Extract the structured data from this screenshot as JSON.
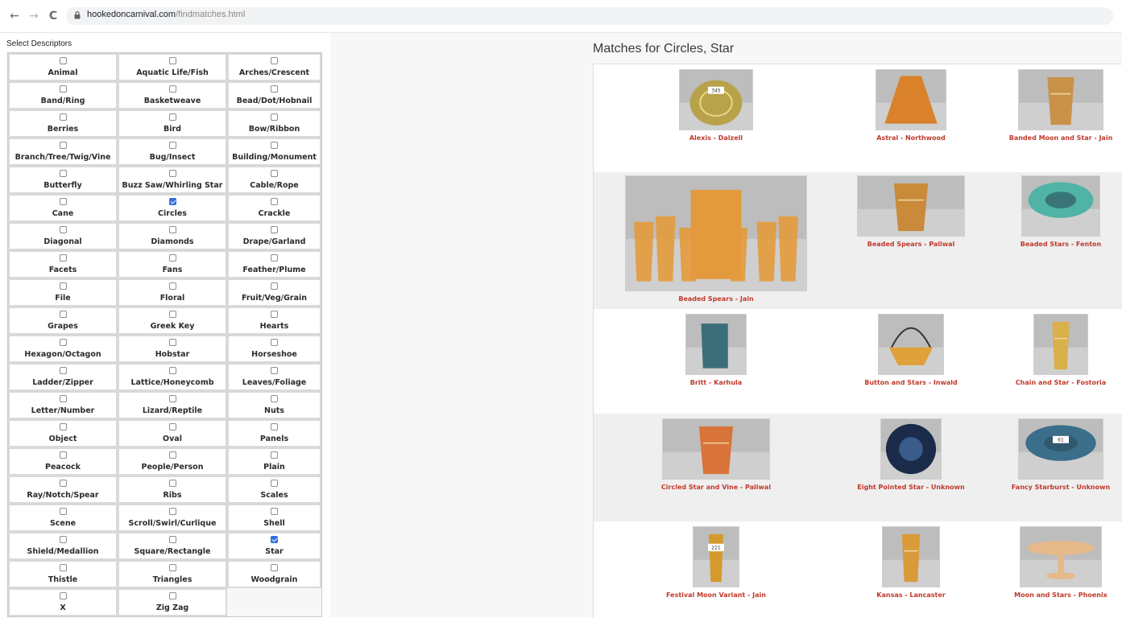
{
  "browser": {
    "back": "←",
    "forward": "→",
    "reload": "C",
    "url_host": "hookedoncarnival.com",
    "url_path": "/findmatches.html"
  },
  "descriptors": {
    "title": "Select Descriptors",
    "items": [
      {
        "label": "Animal",
        "checked": false
      },
      {
        "label": "Aquatic Life/Fish",
        "checked": false
      },
      {
        "label": "Arches/Crescent",
        "checked": false
      },
      {
        "label": "Band/Ring",
        "checked": false
      },
      {
        "label": "Basketweave",
        "checked": false
      },
      {
        "label": "Bead/Dot/Hobnail",
        "checked": false
      },
      {
        "label": "Berries",
        "checked": false
      },
      {
        "label": "Bird",
        "checked": false
      },
      {
        "label": "Bow/Ribbon",
        "checked": false
      },
      {
        "label": "Branch/Tree/Twig/Vine",
        "checked": false
      },
      {
        "label": "Bug/Insect",
        "checked": false
      },
      {
        "label": "Building/Monument",
        "checked": false
      },
      {
        "label": "Butterfly",
        "checked": false
      },
      {
        "label": "Buzz Saw/Whirling Star",
        "checked": false
      },
      {
        "label": "Cable/Rope",
        "checked": false
      },
      {
        "label": "Cane",
        "checked": false
      },
      {
        "label": "Circles",
        "checked": true
      },
      {
        "label": "Crackle",
        "checked": false
      },
      {
        "label": "Diagonal",
        "checked": false
      },
      {
        "label": "Diamonds",
        "checked": false
      },
      {
        "label": "Drape/Garland",
        "checked": false
      },
      {
        "label": "Facets",
        "checked": false
      },
      {
        "label": "Fans",
        "checked": false
      },
      {
        "label": "Feather/Plume",
        "checked": false
      },
      {
        "label": "File",
        "checked": false
      },
      {
        "label": "Floral",
        "checked": false
      },
      {
        "label": "Fruit/Veg/Grain",
        "checked": false
      },
      {
        "label": "Grapes",
        "checked": false
      },
      {
        "label": "Greek Key",
        "checked": false
      },
      {
        "label": "Hearts",
        "checked": false
      },
      {
        "label": "Hexagon/Octagon",
        "checked": false
      },
      {
        "label": "Hobstar",
        "checked": false
      },
      {
        "label": "Horseshoe",
        "checked": false
      },
      {
        "label": "Ladder/Zipper",
        "checked": false
      },
      {
        "label": "Lattice/Honeycomb",
        "checked": false
      },
      {
        "label": "Leaves/Foliage",
        "checked": false
      },
      {
        "label": "Letter/Number",
        "checked": false
      },
      {
        "label": "Lizard/Reptile",
        "checked": false
      },
      {
        "label": "Nuts",
        "checked": false
      },
      {
        "label": "Object",
        "checked": false
      },
      {
        "label": "Oval",
        "checked": false
      },
      {
        "label": "Panels",
        "checked": false
      },
      {
        "label": "Peacock",
        "checked": false
      },
      {
        "label": "People/Person",
        "checked": false
      },
      {
        "label": "Plain",
        "checked": false
      },
      {
        "label": "Ray/Notch/Spear",
        "checked": false
      },
      {
        "label": "Ribs",
        "checked": false
      },
      {
        "label": "Scales",
        "checked": false
      },
      {
        "label": "Scene",
        "checked": false
      },
      {
        "label": "Scroll/Swirl/Curlique",
        "checked": false
      },
      {
        "label": "Shell",
        "checked": false
      },
      {
        "label": "Shield/Medallion",
        "checked": false
      },
      {
        "label": "Square/Rectangle",
        "checked": false
      },
      {
        "label": "Star",
        "checked": true
      },
      {
        "label": "Thistle",
        "checked": false
      },
      {
        "label": "Triangles",
        "checked": false
      },
      {
        "label": "Woodgrain",
        "checked": false
      },
      {
        "label": "X",
        "checked": false
      },
      {
        "label": "Zig Zag",
        "checked": false
      }
    ]
  },
  "matches": {
    "title": "Matches for Circles, Star",
    "items": [
      {
        "label": "Alexis - Dalzell",
        "kind": "vase",
        "color": "#b8a24a",
        "tag": "345"
      },
      {
        "label": "Astral - Northwood",
        "kind": "shade",
        "color": "#d9822b"
      },
      {
        "label": "Banded Moon and Star - Jain",
        "kind": "tumbler",
        "color": "#c9924a"
      },
      {
        "label": "Beaded Spears - Jain",
        "kind": "set",
        "color": "#e39a3c"
      },
      {
        "label": "Beaded Spears - Paliwal",
        "kind": "tumbler",
        "color": "#c98a3a"
      },
      {
        "label": "Beaded Stars - Fenton",
        "kind": "bowl",
        "color": "#4fb3a5"
      },
      {
        "label": "Britt - Karhula",
        "kind": "pitcher",
        "color": "#3c6e7a"
      },
      {
        "label": "Button and Stars - Inwald",
        "kind": "basket",
        "color": "#e0a03a"
      },
      {
        "label": "Chain and Star - Fostoria",
        "kind": "tumbler",
        "color": "#d9b04a"
      },
      {
        "label": "Circled Star and Vine - Paliwal",
        "kind": "tumbler",
        "color": "#d8743a"
      },
      {
        "label": "Eight Pointed Star - Unknown",
        "kind": "disc",
        "color": "#1b2b4a"
      },
      {
        "label": "Fancy Starburst - Unknown",
        "kind": "bowl",
        "color": "#3a6e8a",
        "tag": "61"
      },
      {
        "label": "Festival Moon Variant - Jain",
        "kind": "tumbler",
        "color": "#d49a2e",
        "tag": "221"
      },
      {
        "label": "Kansas - Lancaster",
        "kind": "tumbler",
        "color": "#d99a3a"
      },
      {
        "label": "Moon and Stars - Phoenix",
        "kind": "compote",
        "color": "#e6b98a"
      }
    ]
  }
}
